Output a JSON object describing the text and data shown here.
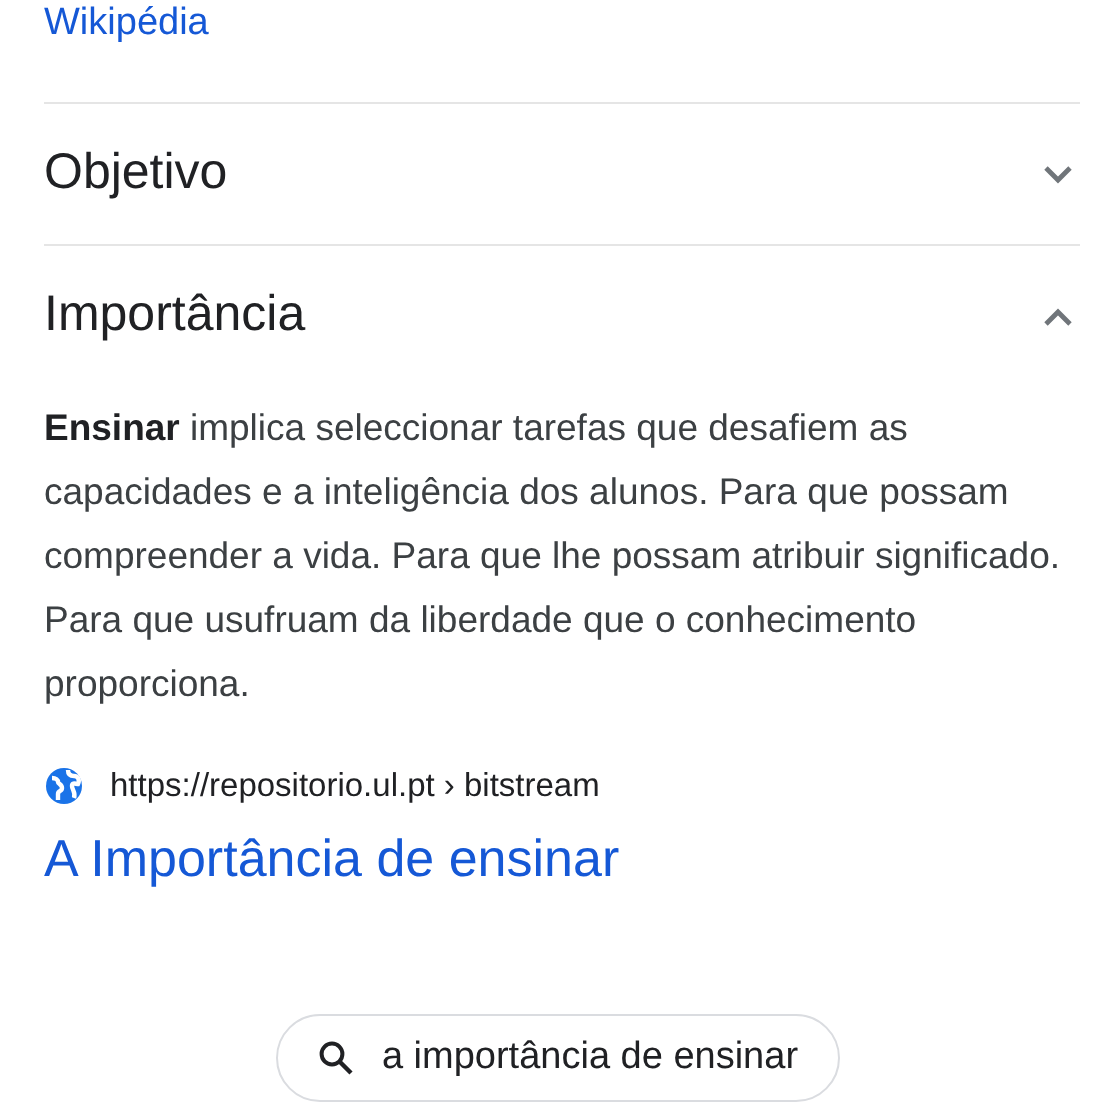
{
  "source_link": "Wikipédia",
  "sections": [
    {
      "title": "Objetivo",
      "expanded": false
    },
    {
      "title": "Importância",
      "expanded": true,
      "text": "**Ensinar** implica seleccionar tarefas que desafiem as capacidades e a inteligência dos alunos. Para que possam compreender a vida. Para que lhe possam atribuir significado. Para que usufruam da liberdade que o conhecimento proporciona.",
      "url": "https://repositorio.ul.pt › bitstream",
      "link_title": "A Importância de ensinar"
    }
  ],
  "related_search": "a importância de ensinar"
}
